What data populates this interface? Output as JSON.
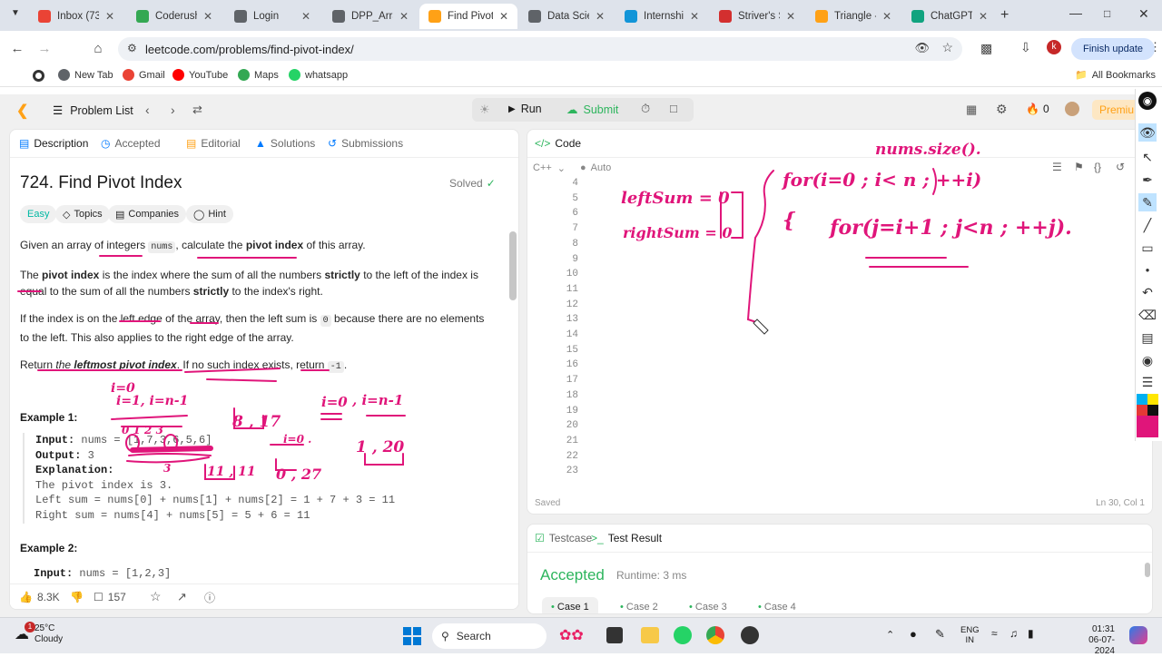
{
  "browser": {
    "tabs": [
      {
        "label": "Inbox (73)",
        "icon": "gmail-icon",
        "color": "#ea4335"
      },
      {
        "label": "Coderush",
        "icon": "sheets-icon",
        "color": "#34a853"
      },
      {
        "label": "Login",
        "icon": "globe-icon",
        "color": "#5f6368"
      },
      {
        "label": "DPP_Array",
        "icon": "globe-icon",
        "color": "#5f6368"
      },
      {
        "label": "Find Pivot",
        "icon": "leetcode-icon",
        "color": "#ffa116"
      },
      {
        "label": "Data Scien",
        "icon": "globe-icon",
        "color": "#5f6368"
      },
      {
        "label": "Internship",
        "icon": "internshala-icon",
        "color": "#1295d8"
      },
      {
        "label": "Striver's SE",
        "icon": "takeuforward-icon",
        "color": "#d32f2f"
      },
      {
        "label": "Triangle -",
        "icon": "leetcode-icon",
        "color": "#ffa116"
      },
      {
        "label": "ChatGPT",
        "icon": "chatgpt-icon",
        "color": "#10a37f"
      }
    ],
    "active_tab": 4,
    "url": "leetcode.com/problems/find-pivot-index/",
    "finish_update": "Finish update",
    "bookmarks": [
      {
        "label": "New Tab",
        "color": "#5f6368"
      },
      {
        "label": "Gmail",
        "color": "#ea4335"
      },
      {
        "label": "YouTube",
        "color": "#ff0000"
      },
      {
        "label": "Maps",
        "color": "#34a853"
      },
      {
        "label": "whatsapp",
        "color": "#25d366"
      }
    ],
    "all_bookmarks": "All Bookmarks",
    "profile_initial": "k"
  },
  "lc": {
    "problem_list": "Problem List",
    "run": "Run",
    "submit": "Submit",
    "streak": "0",
    "premium": "Premiu",
    "tabs": [
      "Description",
      "Accepted",
      "Editorial",
      "Solutions",
      "Submissions"
    ],
    "title": "724. Find Pivot Index",
    "solved": "Solved",
    "difficulty": "Easy",
    "chips": [
      "Topics",
      "Companies",
      "Hint"
    ],
    "p1a": "Given an array of integers ",
    "p1code": "nums",
    "p1b": ", calculate the ",
    "p1bold": "pivot index",
    "p1c": " of this array.",
    "p2a": "The ",
    "p2bold": "pivot index",
    "p2b": " is the index where the sum of all the numbers ",
    "p2bold2": "strictly",
    "p2c": " to the left of the index is equal to the sum of all the numbers ",
    "p2bold3": "strictly",
    "p2d": " to the index's right.",
    "p3a": "If the index is on the left edge of the array, then the left sum is ",
    "p3code": "0",
    "p3b": " because there are no elements to the left. This also applies to the right edge of the array.",
    "p4a": "Return ",
    "p4italic": "the ",
    "p4bolditalic": "leftmost pivot index",
    "p4b": ". If no such index exists, return ",
    "p4code": "-1",
    "p4c": ".",
    "ex1": "Example 1:",
    "ex1_lines": [
      {
        "k": "Input:",
        "v": " nums = [1,7,3,6,5,6]"
      },
      {
        "k": "Output:",
        "v": " 3"
      },
      {
        "k": "Explanation:",
        "v": ""
      },
      {
        "k": "",
        "v": "The pivot index is 3."
      },
      {
        "k": "",
        "v": "Left sum = nums[0] + nums[1] + nums[2] = 1 + 7 + 3 = 11"
      },
      {
        "k": "",
        "v": "Right sum = nums[4] + nums[5] = 5 + 6 = 11"
      }
    ],
    "ex2": "Example 2:",
    "ex2_input_k": "Input:",
    "ex2_input_v": " nums = [1,2,3]",
    "likes": "8.3K",
    "comments": "157",
    "code_tab": "Code",
    "lang": "C++",
    "auto": "Auto",
    "line_numbers": [
      "4",
      "5",
      "6",
      "7",
      "8",
      "9",
      "10",
      "11",
      "12",
      "13",
      "14",
      "15",
      "16",
      "17",
      "18",
      "19",
      "20",
      "21",
      "22",
      "23"
    ],
    "saved": "Saved",
    "cursor_pos": "Ln 30, Col 1",
    "testcase": "Testcase",
    "test_result": "Test Result",
    "accepted": "Accepted",
    "runtime": "Runtime: 3 ms",
    "cases": [
      "Case 1",
      "Case 2",
      "Case 3",
      "Case 4"
    ]
  },
  "ink": {
    "color": "#e0157a",
    "i0": "i=0",
    "i1": "i=1, i=n-1",
    "idx": "0 1 2 3",
    "three": "3",
    "eight17": "8 , 17",
    "i0b": "i=0 .",
    "r1111": "11 , 11",
    "z27": "0 , 27",
    "i0c": "i=0",
    "in1": ", i=n-1",
    "one20": "1 , 20",
    "leftSum": "leftSum = 0",
    "rightSum": "rightSum = 0",
    "for1": "for(i=0 ; i< n ; ++i)",
    "brace": "{",
    "for2": "for(j=i+1 ; j<n ; ++j).",
    "numsSize": "nums.size()."
  },
  "taskbar": {
    "temp": "25°C",
    "weather": "Cloudy",
    "search": "Search",
    "lang1": "ENG",
    "lang2": "IN",
    "time": "01:31",
    "date": "06-07-2024"
  }
}
